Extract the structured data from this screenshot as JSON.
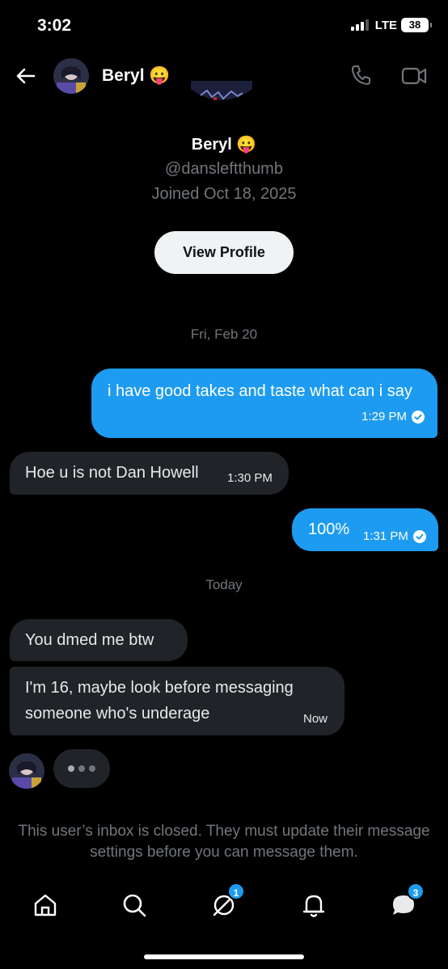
{
  "status_bar": {
    "time": "3:02",
    "network": "LTE",
    "battery": "38"
  },
  "header": {
    "name": "Beryl 😛"
  },
  "profile": {
    "name": "Beryl 😛",
    "handle": "@dansleftthumb",
    "joined": "Joined Oct 18, 2025",
    "view_profile_label": "View Profile"
  },
  "messages": {
    "date1": "Fri, Feb 20",
    "m1": {
      "text": "i have good takes and taste what can i say",
      "time": "1:29 PM"
    },
    "m2": {
      "text": "Hoe u is not Dan Howell",
      "time": "1:30 PM"
    },
    "m3": {
      "text": "100%",
      "time": "1:31 PM"
    },
    "date2": "Today",
    "m4": {
      "text": "You dmed me btw"
    },
    "m5": {
      "text": "I'm 16, maybe look before messaging someone who's underage",
      "time": "Now"
    }
  },
  "inbox_notice": "This user’s inbox is closed. They must update their message settings before you can message them.",
  "nav": {
    "communities_badge": "1",
    "messages_badge": "3"
  },
  "colors": {
    "accent": "#1d9bf0",
    "background": "#000000",
    "received_bubble": "#202327",
    "muted_text": "#71767b"
  },
  "icons": [
    "back-arrow-icon",
    "phone-icon",
    "video-icon",
    "home-icon",
    "search-icon",
    "grok-icon",
    "bell-icon",
    "messages-icon",
    "read-check-icon"
  ]
}
